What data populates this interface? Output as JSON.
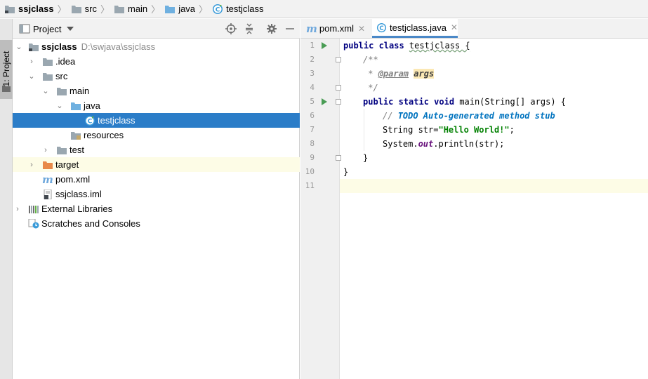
{
  "breadcrumb": [
    {
      "label": "ssjclass",
      "icon": "project-folder-icon",
      "bold": true
    },
    {
      "label": "src",
      "icon": "folder-icon"
    },
    {
      "label": "main",
      "icon": "folder-icon"
    },
    {
      "label": "java",
      "icon": "source-folder-icon"
    },
    {
      "label": "testjclass",
      "icon": "java-class-icon"
    }
  ],
  "sidebar": {
    "tab_label": "1: Project"
  },
  "project_panel": {
    "title": "Project",
    "tree": [
      {
        "label": "ssjclass",
        "path": "D:\\swjava\\ssjclass",
        "icon": "project-folder-icon",
        "expanded": true
      },
      {
        "label": ".idea",
        "icon": "folder-icon",
        "expanded": false
      },
      {
        "label": "src",
        "icon": "folder-icon",
        "expanded": true
      },
      {
        "label": "main",
        "icon": "folder-icon",
        "expanded": true
      },
      {
        "label": "java",
        "icon": "source-folder-icon",
        "expanded": true
      },
      {
        "label": "testjclass",
        "icon": "java-class-icon",
        "selected": true
      },
      {
        "label": "resources",
        "icon": "resources-folder-icon"
      },
      {
        "label": "test",
        "icon": "folder-icon",
        "expanded": false
      },
      {
        "label": "target",
        "icon": "excluded-folder-icon",
        "expanded": false
      },
      {
        "label": "pom.xml",
        "icon": "maven-icon"
      },
      {
        "label": "ssjclass.iml",
        "icon": "iml-file-icon"
      },
      {
        "label": "External Libraries",
        "icon": "libraries-icon",
        "expanded": false
      },
      {
        "label": "Scratches and Consoles",
        "icon": "scratches-icon"
      }
    ]
  },
  "editor": {
    "tabs": [
      {
        "label": "pom.xml",
        "icon": "maven-icon",
        "active": false
      },
      {
        "label": "testjclass.java",
        "icon": "java-class-icon",
        "active": true
      }
    ],
    "line_numbers": [
      "1",
      "2",
      "3",
      "4",
      "5",
      "6",
      "7",
      "8",
      "9",
      "10",
      "11"
    ],
    "code": {
      "l1_kw": "public class ",
      "l1_name": "testjclass {",
      "l2": "/**",
      "l3_star": " * ",
      "l3_tag": "@param",
      "l3_val": "args",
      "l4": " */",
      "l5_kw": "public static void ",
      "l5_rest": "main(String[] args) {",
      "l6_prefix": "// ",
      "l6_todo": "TODO Auto-generated method stub",
      "l7_a": "String str=",
      "l7_str": "\"Hello World!\"",
      "l7_b": ";",
      "l8_a": "System.",
      "l8_fld": "out",
      "l8_b": ".println(str);",
      "l9": "}",
      "l10": "}"
    }
  },
  "colors": {
    "selection": "#2b7dc8",
    "keyword": "#000080",
    "string": "#008000",
    "todo": "#0073bf",
    "run_arrow": "#499c54"
  }
}
